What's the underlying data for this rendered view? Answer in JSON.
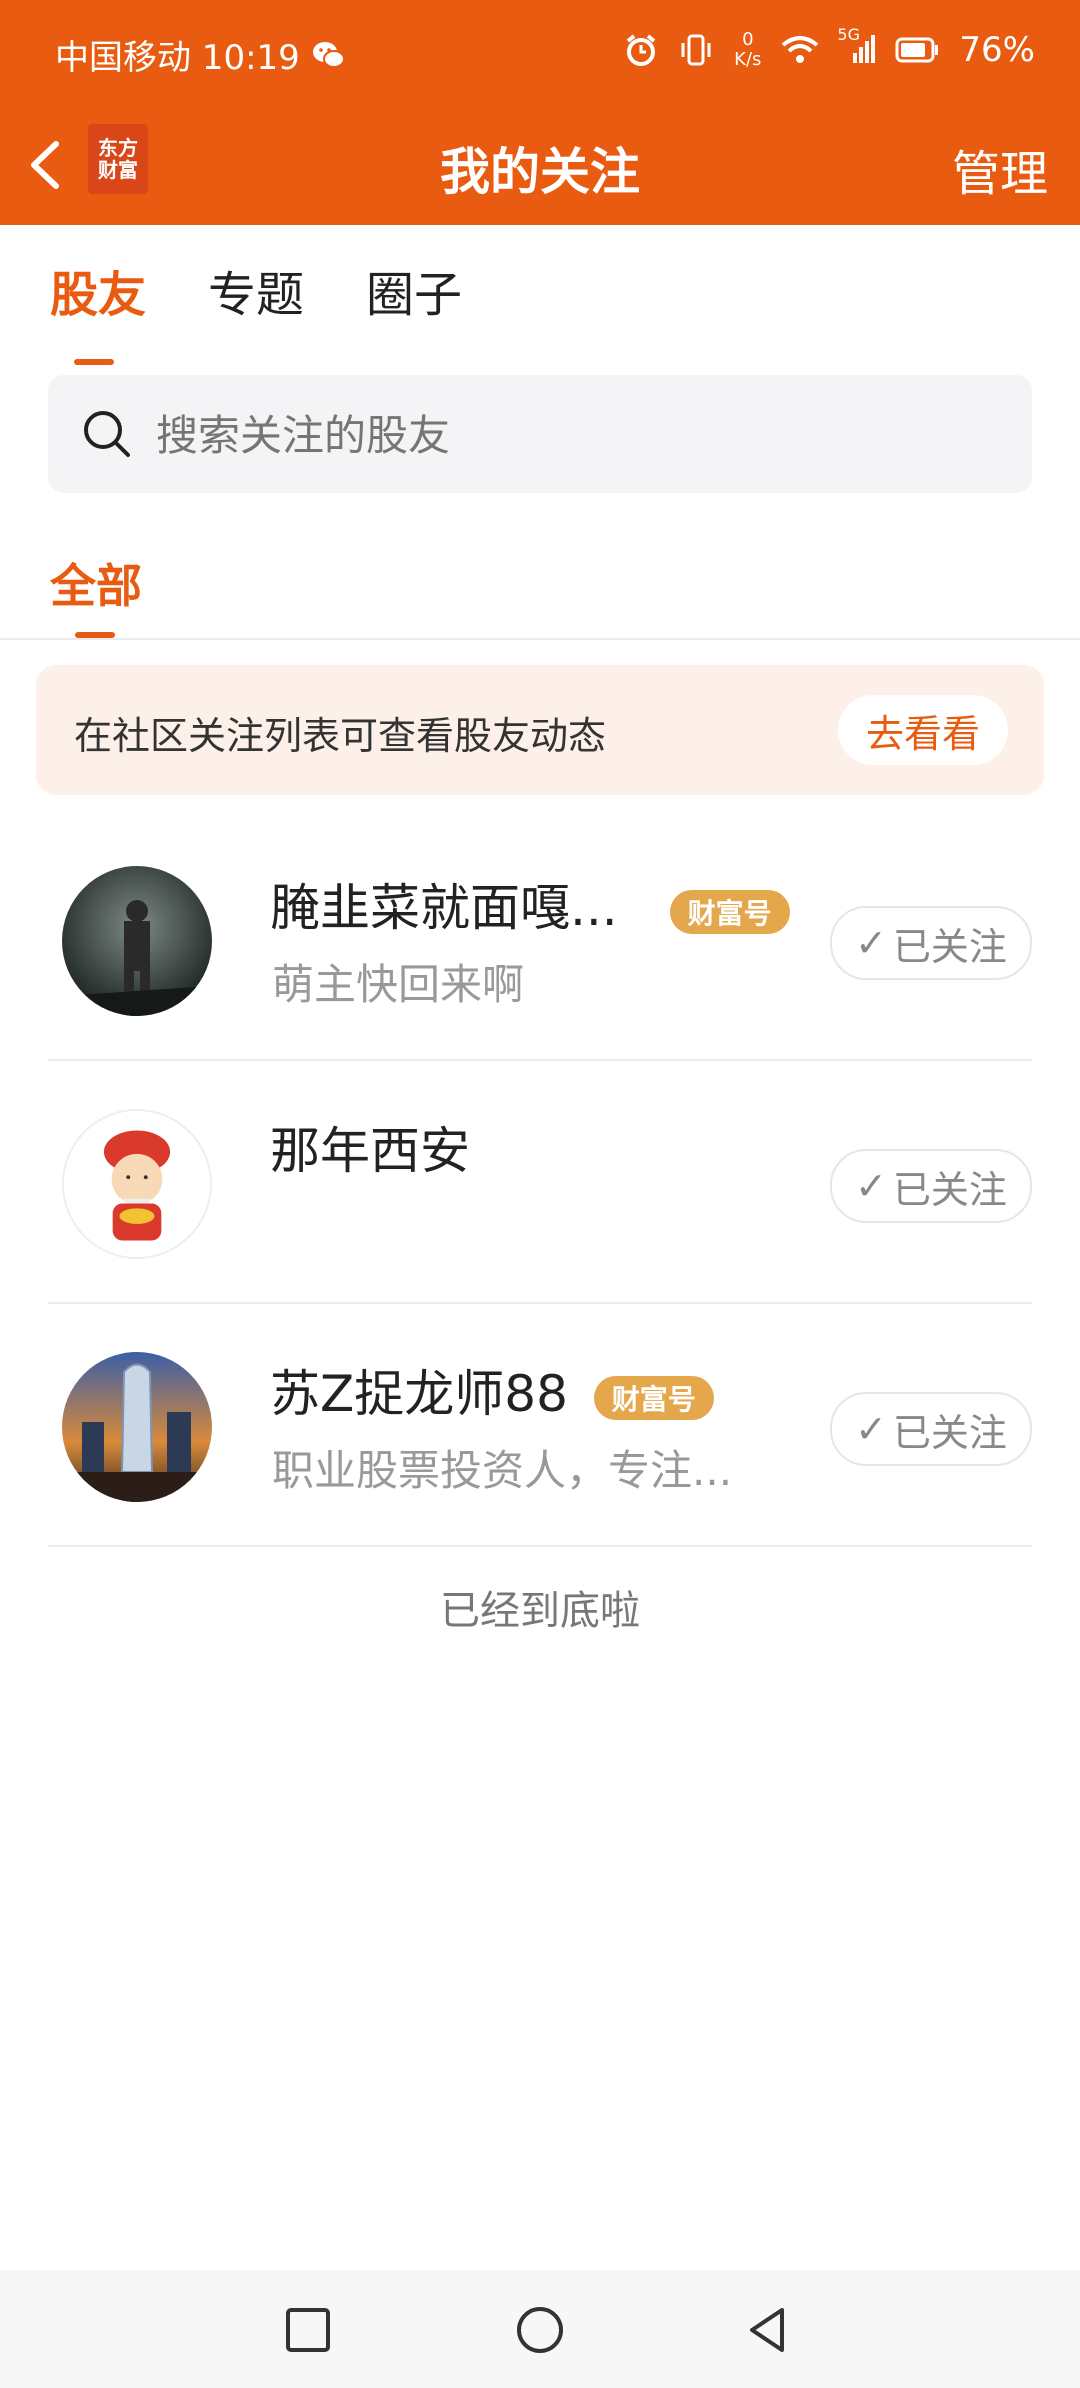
{
  "status_bar": {
    "carrier_time": "中国移动 10:19",
    "net_speed_top": "0",
    "net_speed_bottom": "K/s",
    "signal_label": "5G",
    "battery": "76%"
  },
  "header": {
    "logo_line1": "东方",
    "logo_line2": "财富",
    "title": "我的关注",
    "manage_label": "管理"
  },
  "tabs": [
    {
      "label": "股友",
      "active": true
    },
    {
      "label": "专题",
      "active": false
    },
    {
      "label": "圈子",
      "active": false
    }
  ],
  "search": {
    "placeholder": "搜索关注的股友"
  },
  "filter": {
    "all_label": "全部"
  },
  "banner": {
    "text": "在社区关注列表可查看股友动态",
    "button": "去看看"
  },
  "users": [
    {
      "name": "腌韭菜就面嘎...",
      "badge": "财富号",
      "desc": "萌主快回来啊",
      "follow": "已关注"
    },
    {
      "name": "那年西安",
      "badge": "",
      "desc": "",
      "follow": "已关注"
    },
    {
      "name": "苏Z捉龙师88",
      "badge": "财富号",
      "desc": "职业股票投资人，专注...",
      "follow": "已关注"
    }
  ],
  "footer": {
    "end_text": "已经到底啦"
  },
  "colors": {
    "accent": "#E85B10",
    "badge": "#E4A74B"
  }
}
